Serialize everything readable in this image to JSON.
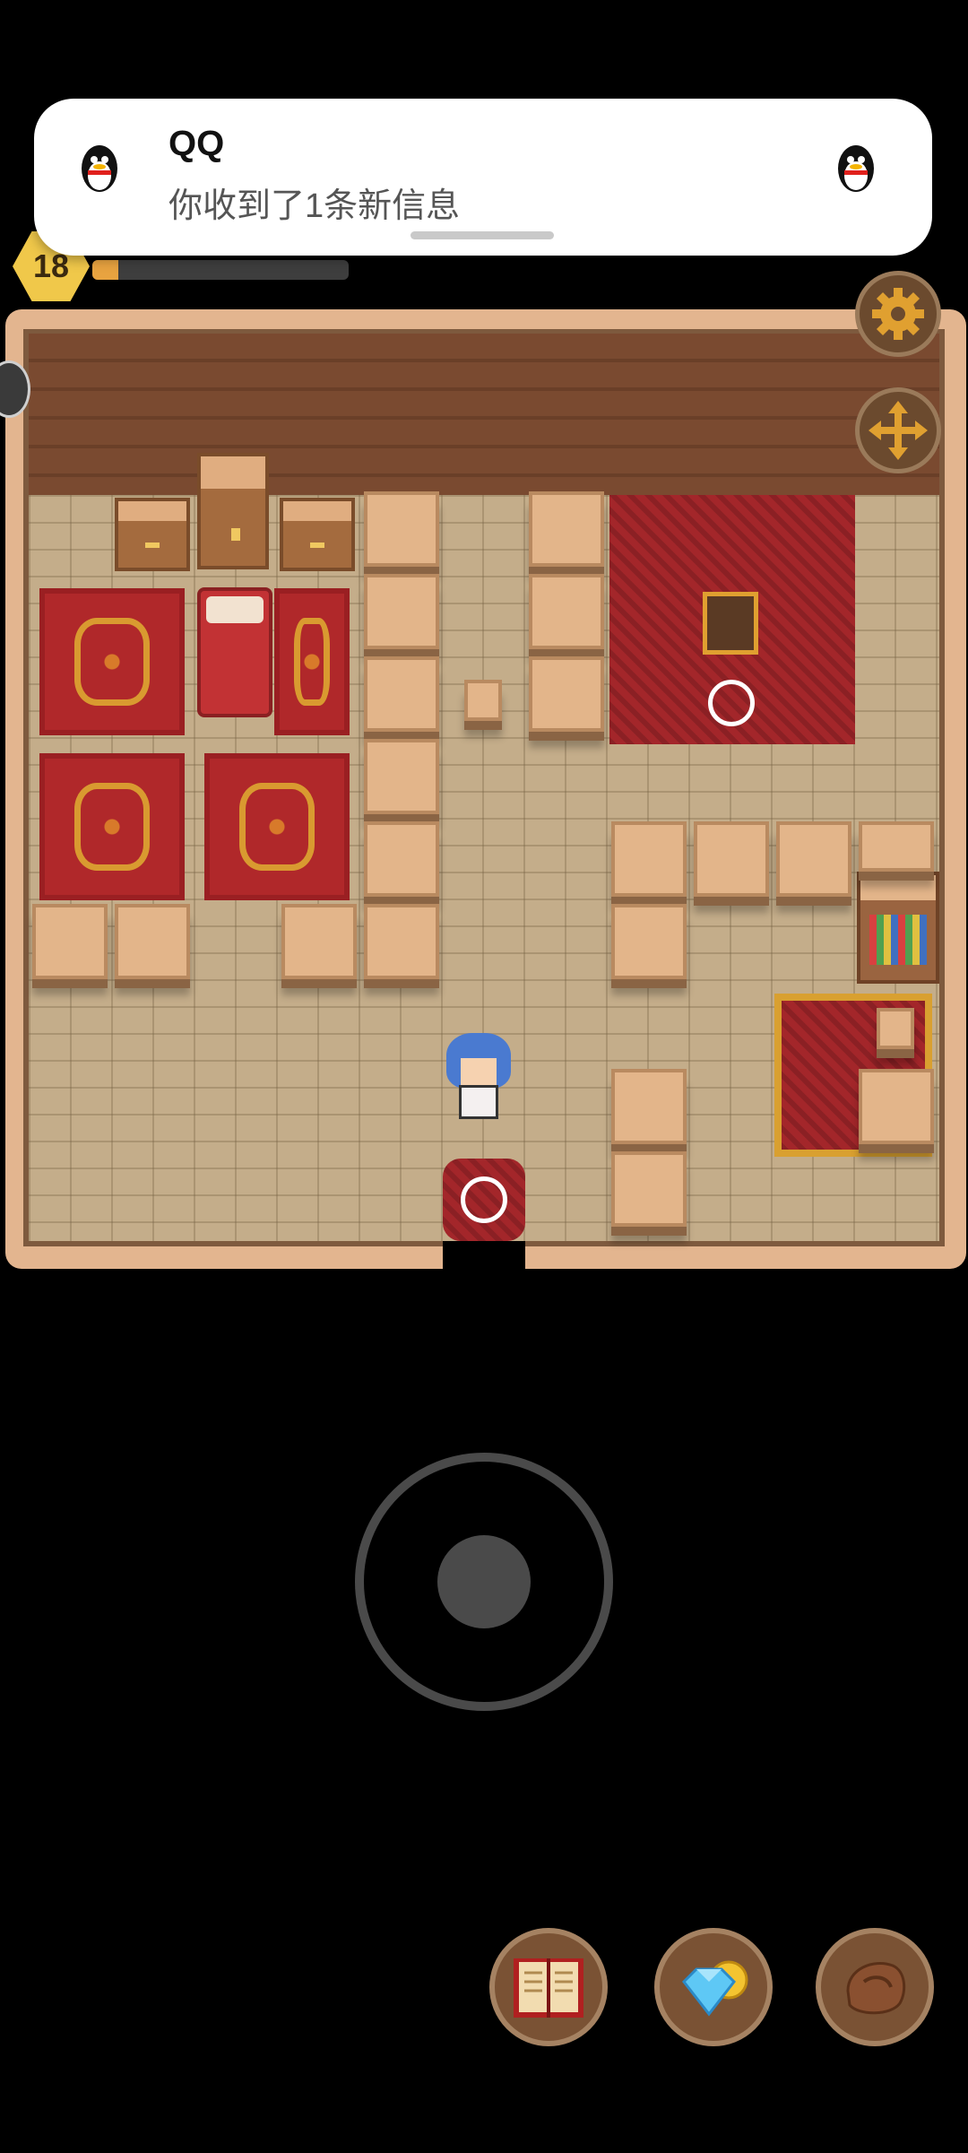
{
  "notification": {
    "app": "QQ",
    "message": "你收到了1条新信息"
  },
  "hud": {
    "level": "18",
    "xp_fraction": 0.1
  },
  "colors": {
    "rug_red": "#b0282a",
    "crate": "#e3b58a",
    "floor": "#c4ad8a",
    "gold_accent": "#d99a30"
  },
  "icons": {
    "settings": "gear-icon",
    "move": "move-arrows-icon",
    "journal": "book-icon",
    "shop": "gem-coin-icon",
    "inventory": "bag-icon"
  }
}
